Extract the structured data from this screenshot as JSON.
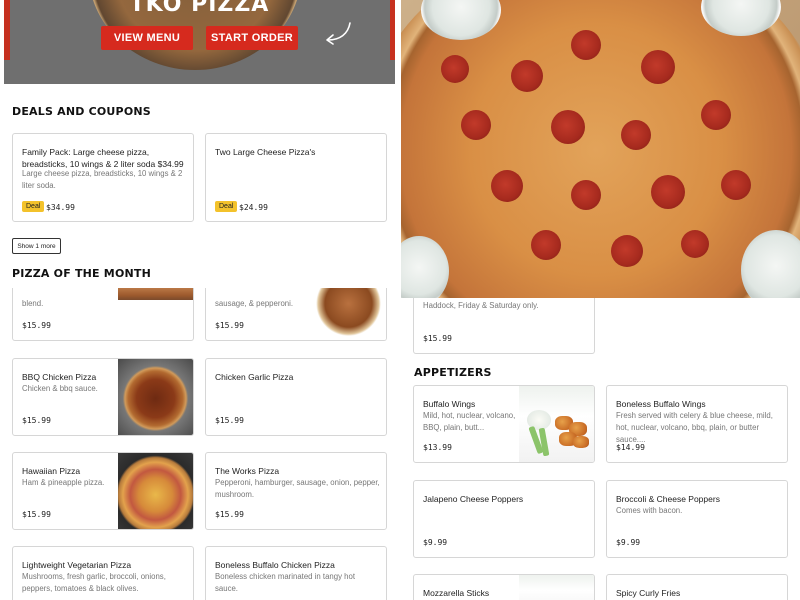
{
  "hero": {
    "title": "TKO PIZZA",
    "view_menu_label": "VIEW MENU",
    "start_order_label": "START ORDER"
  },
  "deals": {
    "heading": "DEALS AND COUPONS",
    "cards": [
      {
        "title": "Family Pack: Large cheese pizza, breadsticks, 10 wings & 2 liter soda $34.99",
        "description": "Large cheese pizza, breadsticks, 10 wings & 2 liter soda.",
        "badge": "Deal",
        "price": "$34.99"
      },
      {
        "title": "Two Large Cheese Pizza's",
        "badge": "Deal",
        "price": "$24.99"
      }
    ],
    "show_more_label": "Show 1 more"
  },
  "pizza_month": {
    "heading": "PIZZA OF THE MONTH",
    "cards": [
      {
        "description": "blend.",
        "price": "$15.99",
        "image": "pizza-photo"
      },
      {
        "description": "sausage, & pepperoni.",
        "price": "$15.99",
        "image": "pizza-photo"
      },
      {
        "title": "BBQ Chicken Pizza",
        "description": "Chicken & bbq sauce.",
        "price": "$15.99",
        "image": "bbq-pizza-photo"
      },
      {
        "title": "Chicken Garlic Pizza",
        "price": "$15.99"
      },
      {
        "title": "Hawaiian Pizza",
        "description": "Ham & pineapple pizza.",
        "price": "$15.99",
        "image": "hawaiian-pizza-photo"
      },
      {
        "title": "The Works Pizza",
        "description": "Pepperoni, hamburger, sausage, onion, pepper, mushroom.",
        "price": "$15.99"
      },
      {
        "title": "Lightweight Vegetarian Pizza",
        "description": "Mushrooms, fresh garlic, broccoli, onions, peppers, tomatoes & black olives."
      },
      {
        "title": "Boneless Buffalo Chicken Pizza",
        "description": "Boneless chicken marinated in tangy hot sauce."
      }
    ]
  },
  "right": {
    "hero_image": "pepperoni-pizza-photo",
    "fish_card": {
      "description": "Haddock, Friday & Saturday only.",
      "price": "$15.99"
    },
    "appetizers": {
      "heading": "APPETIZERS",
      "cards": [
        {
          "title": "Buffalo Wings",
          "description": "Mild, hot, nuclear, volcano, BBQ, plain, butt...",
          "price": "$13.99",
          "image": "wings-photo"
        },
        {
          "title": "Boneless Buffalo Wings",
          "description": "Fresh served with celery & blue cheese, mild, hot, nuclear, volcano, bbq, plain, or butter sauce....",
          "price": "$14.99"
        },
        {
          "title": "Jalapeno Cheese Poppers",
          "price": "$9.99"
        },
        {
          "title": "Broccoli & Cheese Poppers",
          "description": "Comes with bacon.",
          "price": "$9.99"
        },
        {
          "title": "Mozzarella Sticks"
        },
        {
          "title": "Spicy Curly Fries"
        }
      ]
    }
  },
  "colors": {
    "accent_red": "#d62a1e",
    "deal_yellow": "#f3c22b"
  }
}
